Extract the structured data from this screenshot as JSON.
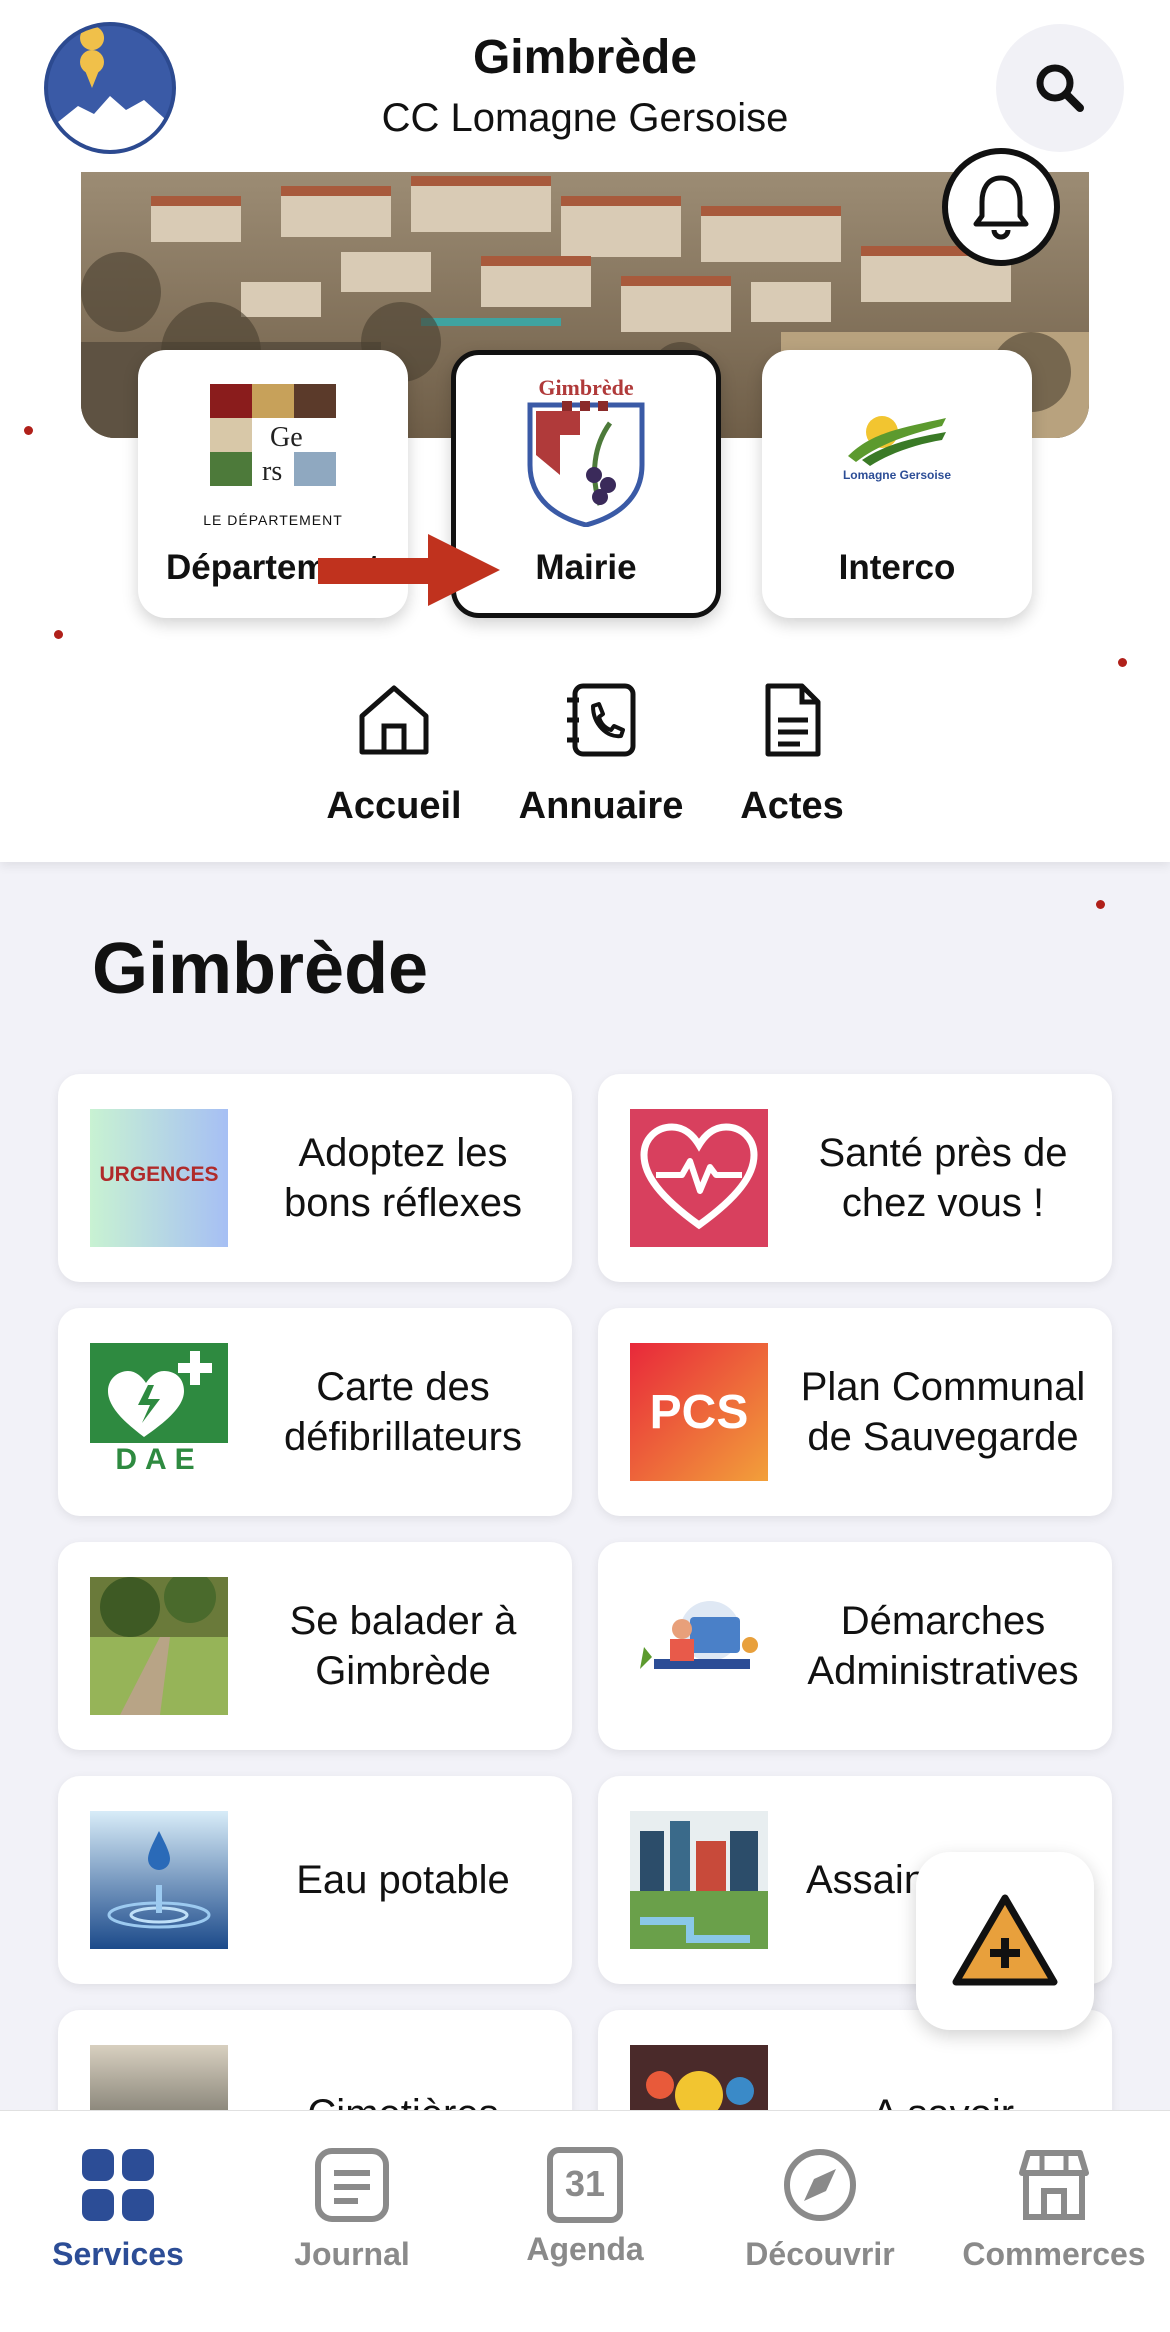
{
  "header": {
    "town": "Gimbrède",
    "intercommunality": "CC Lomagne Gersoise"
  },
  "entities": [
    {
      "label": "Département",
      "logo_text": "LE DÉPARTEMENT"
    },
    {
      "label": "Mairie",
      "logo_text": "Gimbrède"
    },
    {
      "label": "Interco",
      "logo_text": "Lomagne Gersoise"
    }
  ],
  "quick_nav": [
    {
      "label": "Accueil",
      "icon": "home-icon"
    },
    {
      "label": "Annuaire",
      "icon": "phonebook-icon"
    },
    {
      "label": "Actes",
      "icon": "document-icon"
    }
  ],
  "section_title": "Gimbrède",
  "tiles": [
    {
      "label": "Adoptez les bons réflexes",
      "thumb": "URGENCES"
    },
    {
      "label": "Santé près de chez vous !",
      "thumb": "heart-pulse"
    },
    {
      "label": "Carte des défibrillateurs",
      "thumb": "DAE"
    },
    {
      "label": "Plan Communal de Sauvegarde",
      "thumb": "PCS"
    },
    {
      "label": "Se balader à Gimbrède",
      "thumb": "path-photo"
    },
    {
      "label": "Démarches Administratives",
      "thumb": "office-illustration"
    },
    {
      "label": "Eau potable",
      "thumb": "water-drop"
    },
    {
      "label": "Assainissement",
      "thumb": "sanitation-illustration"
    },
    {
      "label": "Cimetières",
      "thumb": "cemetery-photo"
    },
    {
      "label": "A savoir",
      "thumb": "lightbulb-illustration"
    }
  ],
  "bottom_nav": [
    {
      "label": "Services",
      "icon": "grid-icon",
      "active": true
    },
    {
      "label": "Journal",
      "icon": "journal-icon",
      "active": false
    },
    {
      "label": "Agenda",
      "icon": "calendar-icon",
      "active": false,
      "badge": "31"
    },
    {
      "label": "Découvrir",
      "icon": "compass-icon",
      "active": false
    },
    {
      "label": "Commerces",
      "icon": "store-icon",
      "active": false
    }
  ],
  "colors": {
    "accent": "#2c4d96",
    "arrow": "#c0321e",
    "fab_warning": "#e8a03c",
    "inactive": "#8a8a8a"
  }
}
